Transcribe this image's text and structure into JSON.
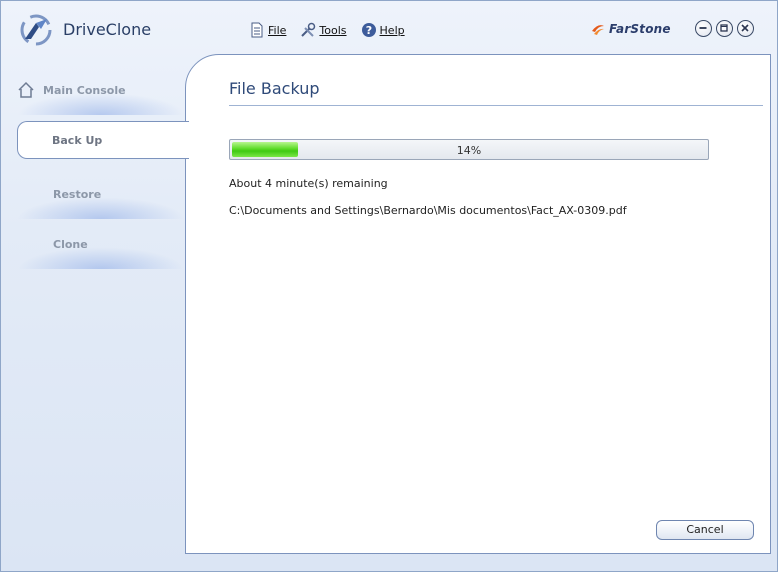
{
  "app": {
    "title": "DriveClone",
    "brand": "FarStone"
  },
  "menu": [
    {
      "label": "File",
      "icon": "document-icon"
    },
    {
      "label": "Tools",
      "icon": "tools-icon"
    },
    {
      "label": "Help",
      "icon": "help-icon"
    }
  ],
  "window_controls": [
    "minimize-icon",
    "maximize-icon",
    "close-icon"
  ],
  "sidebar": {
    "items": [
      {
        "label": "Main Console",
        "icon": "home-icon"
      },
      {
        "label": "Back Up",
        "active": true
      },
      {
        "label": "Restore"
      },
      {
        "label": "Clone"
      }
    ]
  },
  "main": {
    "title": "File Backup",
    "progress": {
      "percent": 14,
      "text": "14%"
    },
    "remaining": "About 4 minute(s) remaining",
    "current_file": "C:\\Documents and Settings\\Bernardo\\Mis documentos\\Fact_AX-0309.pdf",
    "cancel_label": "Cancel"
  },
  "colors": {
    "accent": "#2f4a79",
    "progress_green": "#3fc914",
    "border": "#7c93bd"
  }
}
